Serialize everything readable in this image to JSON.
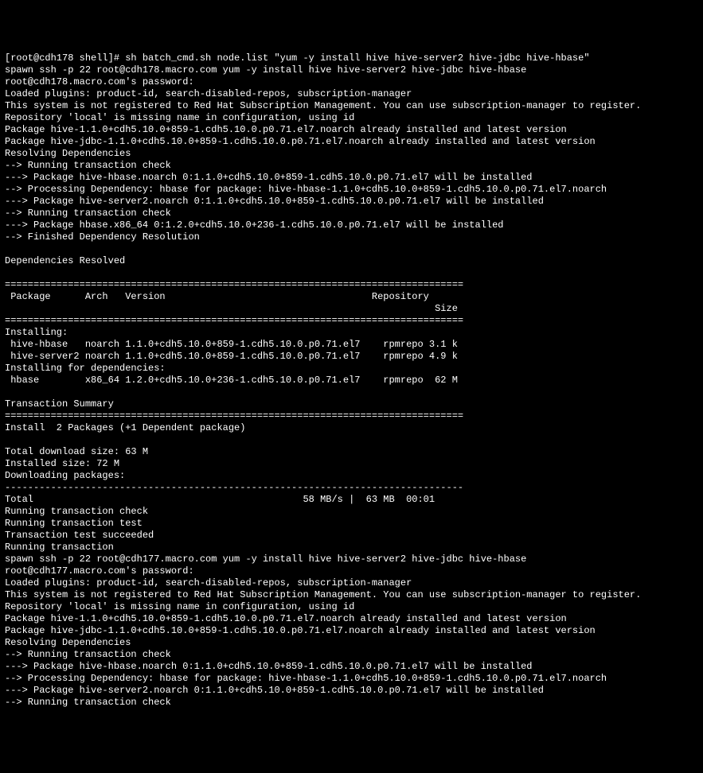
{
  "terminal": {
    "prompt": "[root@cdh178 shell]# sh batch_cmd.sh node.list \"yum -y install hive hive-server2 hive-jdbc hive-hbase\"",
    "lines": [
      "spawn ssh -p 22 root@cdh178.macro.com yum -y install hive hive-server2 hive-jdbc hive-hbase",
      "root@cdh178.macro.com's password:",
      "Loaded plugins: product-id, search-disabled-repos, subscription-manager",
      "This system is not registered to Red Hat Subscription Management. You can use subscription-manager to register.",
      "Repository 'local' is missing name in configuration, using id",
      "Package hive-1.1.0+cdh5.10.0+859-1.cdh5.10.0.p0.71.el7.noarch already installed and latest version",
      "Package hive-jdbc-1.1.0+cdh5.10.0+859-1.cdh5.10.0.p0.71.el7.noarch already installed and latest version",
      "Resolving Dependencies",
      "--> Running transaction check",
      "---> Package hive-hbase.noarch 0:1.1.0+cdh5.10.0+859-1.cdh5.10.0.p0.71.el7 will be installed",
      "--> Processing Dependency: hbase for package: hive-hbase-1.1.0+cdh5.10.0+859-1.cdh5.10.0.p0.71.el7.noarch",
      "---> Package hive-server2.noarch 0:1.1.0+cdh5.10.0+859-1.cdh5.10.0.p0.71.el7 will be installed",
      "--> Running transaction check",
      "---> Package hbase.x86_64 0:1.2.0+cdh5.10.0+236-1.cdh5.10.0.p0.71.el7 will be installed",
      "--> Finished Dependency Resolution",
      "",
      "Dependencies Resolved",
      "",
      "================================================================================",
      " Package      Arch   Version                                    Repository",
      "                                                                           Size",
      "================================================================================",
      "Installing:",
      " hive-hbase   noarch 1.1.0+cdh5.10.0+859-1.cdh5.10.0.p0.71.el7    rpmrepo 3.1 k",
      " hive-server2 noarch 1.1.0+cdh5.10.0+859-1.cdh5.10.0.p0.71.el7    rpmrepo 4.9 k",
      "Installing for dependencies:",
      " hbase        x86_64 1.2.0+cdh5.10.0+236-1.cdh5.10.0.p0.71.el7    rpmrepo  62 M",
      "",
      "Transaction Summary",
      "================================================================================",
      "Install  2 Packages (+1 Dependent package)",
      "",
      "Total download size: 63 M",
      "Installed size: 72 M",
      "Downloading packages:",
      "--------------------------------------------------------------------------------",
      "Total                                               58 MB/s |  63 MB  00:01",
      "Running transaction check",
      "Running transaction test",
      "Transaction test succeeded",
      "Running transaction",
      "spawn ssh -p 22 root@cdh177.macro.com yum -y install hive hive-server2 hive-jdbc hive-hbase",
      "root@cdh177.macro.com's password:",
      "Loaded plugins: product-id, search-disabled-repos, subscription-manager",
      "This system is not registered to Red Hat Subscription Management. You can use subscription-manager to register.",
      "Repository 'local' is missing name in configuration, using id",
      "Package hive-1.1.0+cdh5.10.0+859-1.cdh5.10.0.p0.71.el7.noarch already installed and latest version",
      "Package hive-jdbc-1.1.0+cdh5.10.0+859-1.cdh5.10.0.p0.71.el7.noarch already installed and latest version",
      "Resolving Dependencies",
      "--> Running transaction check",
      "---> Package hive-hbase.noarch 0:1.1.0+cdh5.10.0+859-1.cdh5.10.0.p0.71.el7 will be installed",
      "--> Processing Dependency: hbase for package: hive-hbase-1.1.0+cdh5.10.0+859-1.cdh5.10.0.p0.71.el7.noarch",
      "---> Package hive-server2.noarch 0:1.1.0+cdh5.10.0+859-1.cdh5.10.0.p0.71.el7 will be installed",
      "--> Running transaction check"
    ]
  }
}
